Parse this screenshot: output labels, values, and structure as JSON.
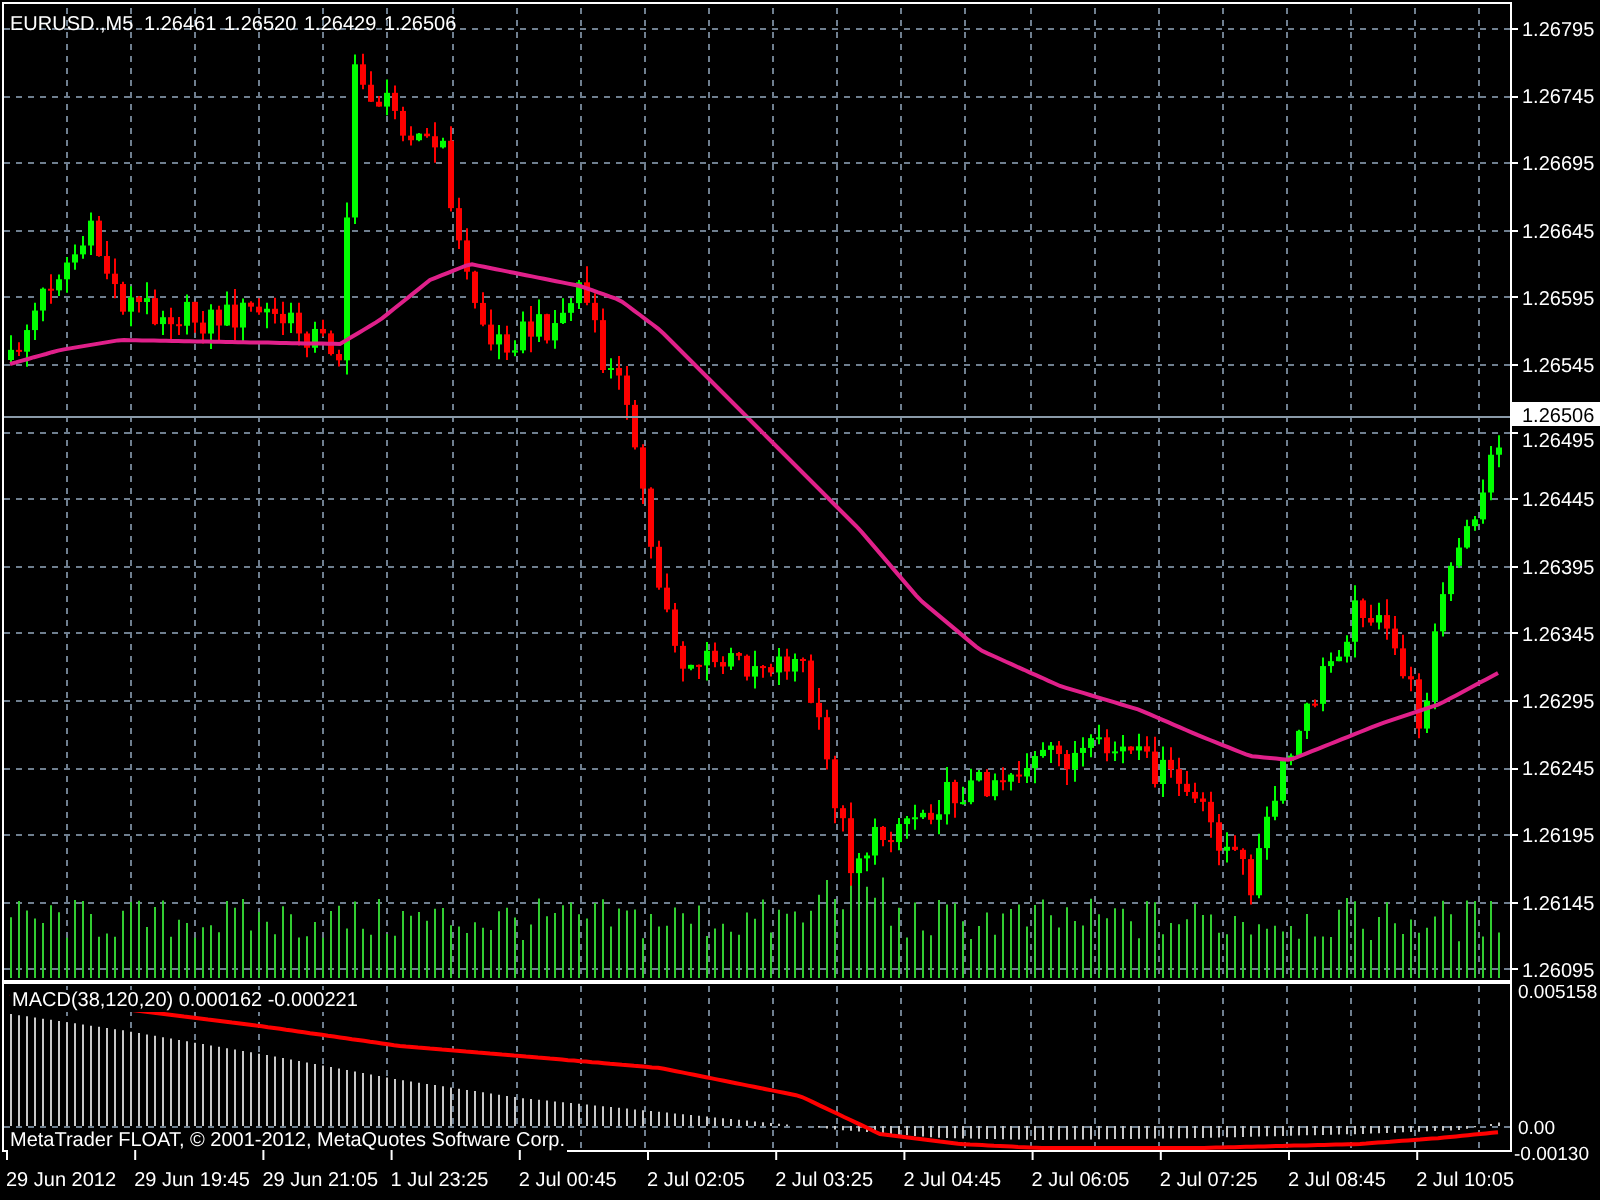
{
  "chart": {
    "symbol": "EURUSD.,M5",
    "ohlc": [
      "1.26461",
      "1.26520",
      "1.26429",
      "1.26506"
    ],
    "price_ticks": [
      "1.26795",
      "1.26745",
      "1.26695",
      "1.26645",
      "1.26595",
      "1.26545",
      "1.26495",
      "1.26445",
      "1.26395",
      "1.26345",
      "1.26295",
      "1.26245",
      "1.26195",
      "1.26145",
      "1.26095"
    ],
    "current_price": "1.26506",
    "time_ticks": [
      "29 Jun 2012",
      "29 Jun 19:45",
      "29 Jun 21:05",
      "1 Jul 23:25",
      "2 Jul 00:45",
      "2 Jul 02:05",
      "2 Jul 03:25",
      "2 Jul 04:45",
      "2 Jul 06:05",
      "2 Jul 07:25",
      "2 Jul 08:45",
      "2 Jul 10:05"
    ],
    "macd": {
      "label": "MACD(38,120,20) 0.000162 -0.000221",
      "ticks": [
        "0.005158",
        "0.00",
        "-0.00130"
      ]
    },
    "copyright": "MetaTrader FLOAT, © 2001-2012, MetaQuotes Software Corp."
  }
}
